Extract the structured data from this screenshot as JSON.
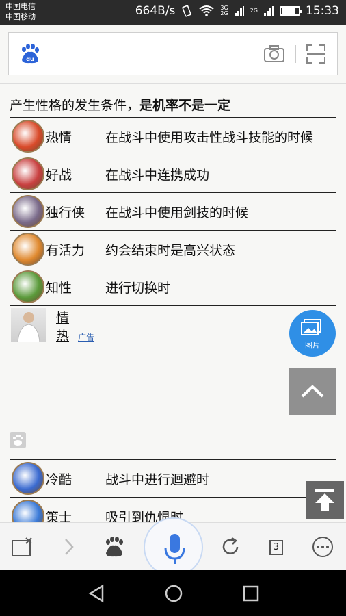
{
  "status_bar": {
    "carrier1": "中国电信",
    "carrier2": "中国移动",
    "net_speed": "664B/s",
    "net_3g": "3G",
    "net_2g": "2G",
    "net_2g_b": "2G",
    "time": "15:33"
  },
  "search": {
    "logo": "du"
  },
  "article": {
    "headline_plain": "产生性格的发生条件，",
    "headline_bold": "是机率不是一定",
    "traits": [
      {
        "name": "热情",
        "condition": "在战斗中使用攻击性战斗技能的时候",
        "icon": "fire-icon",
        "color": "#d94a2a"
      },
      {
        "name": "好战",
        "condition": "在战斗中连携成功",
        "icon": "sword-icon",
        "color": "#c94040"
      },
      {
        "name": "独行侠",
        "condition": "在战斗中使用剑技的时候",
        "icon": "lone-icon",
        "color": "#7a6a8a"
      },
      {
        "name": "有活力",
        "condition": "约会结束时是高兴状态",
        "icon": "vigor-icon",
        "color": "#e08a30"
      },
      {
        "name": "知性",
        "condition": "进行切换时",
        "icon": "book-icon",
        "color": "#5a9a3a"
      }
    ],
    "ad": {
      "title_line1": "情",
      "title_line2": "热",
      "tag": "广告"
    },
    "traits2": [
      {
        "name": "冷酷",
        "condition": "战斗中进行迴避时",
        "icon": "cold-icon",
        "color": "#3a6ad0"
      },
      {
        "name": "策士",
        "condition": "吸引到仇恨时",
        "icon": "tactic-icon",
        "color": "#3a7ad8"
      }
    ]
  },
  "floating": {
    "image_label": "图片"
  },
  "toolbar": {
    "tab_count": "3"
  }
}
